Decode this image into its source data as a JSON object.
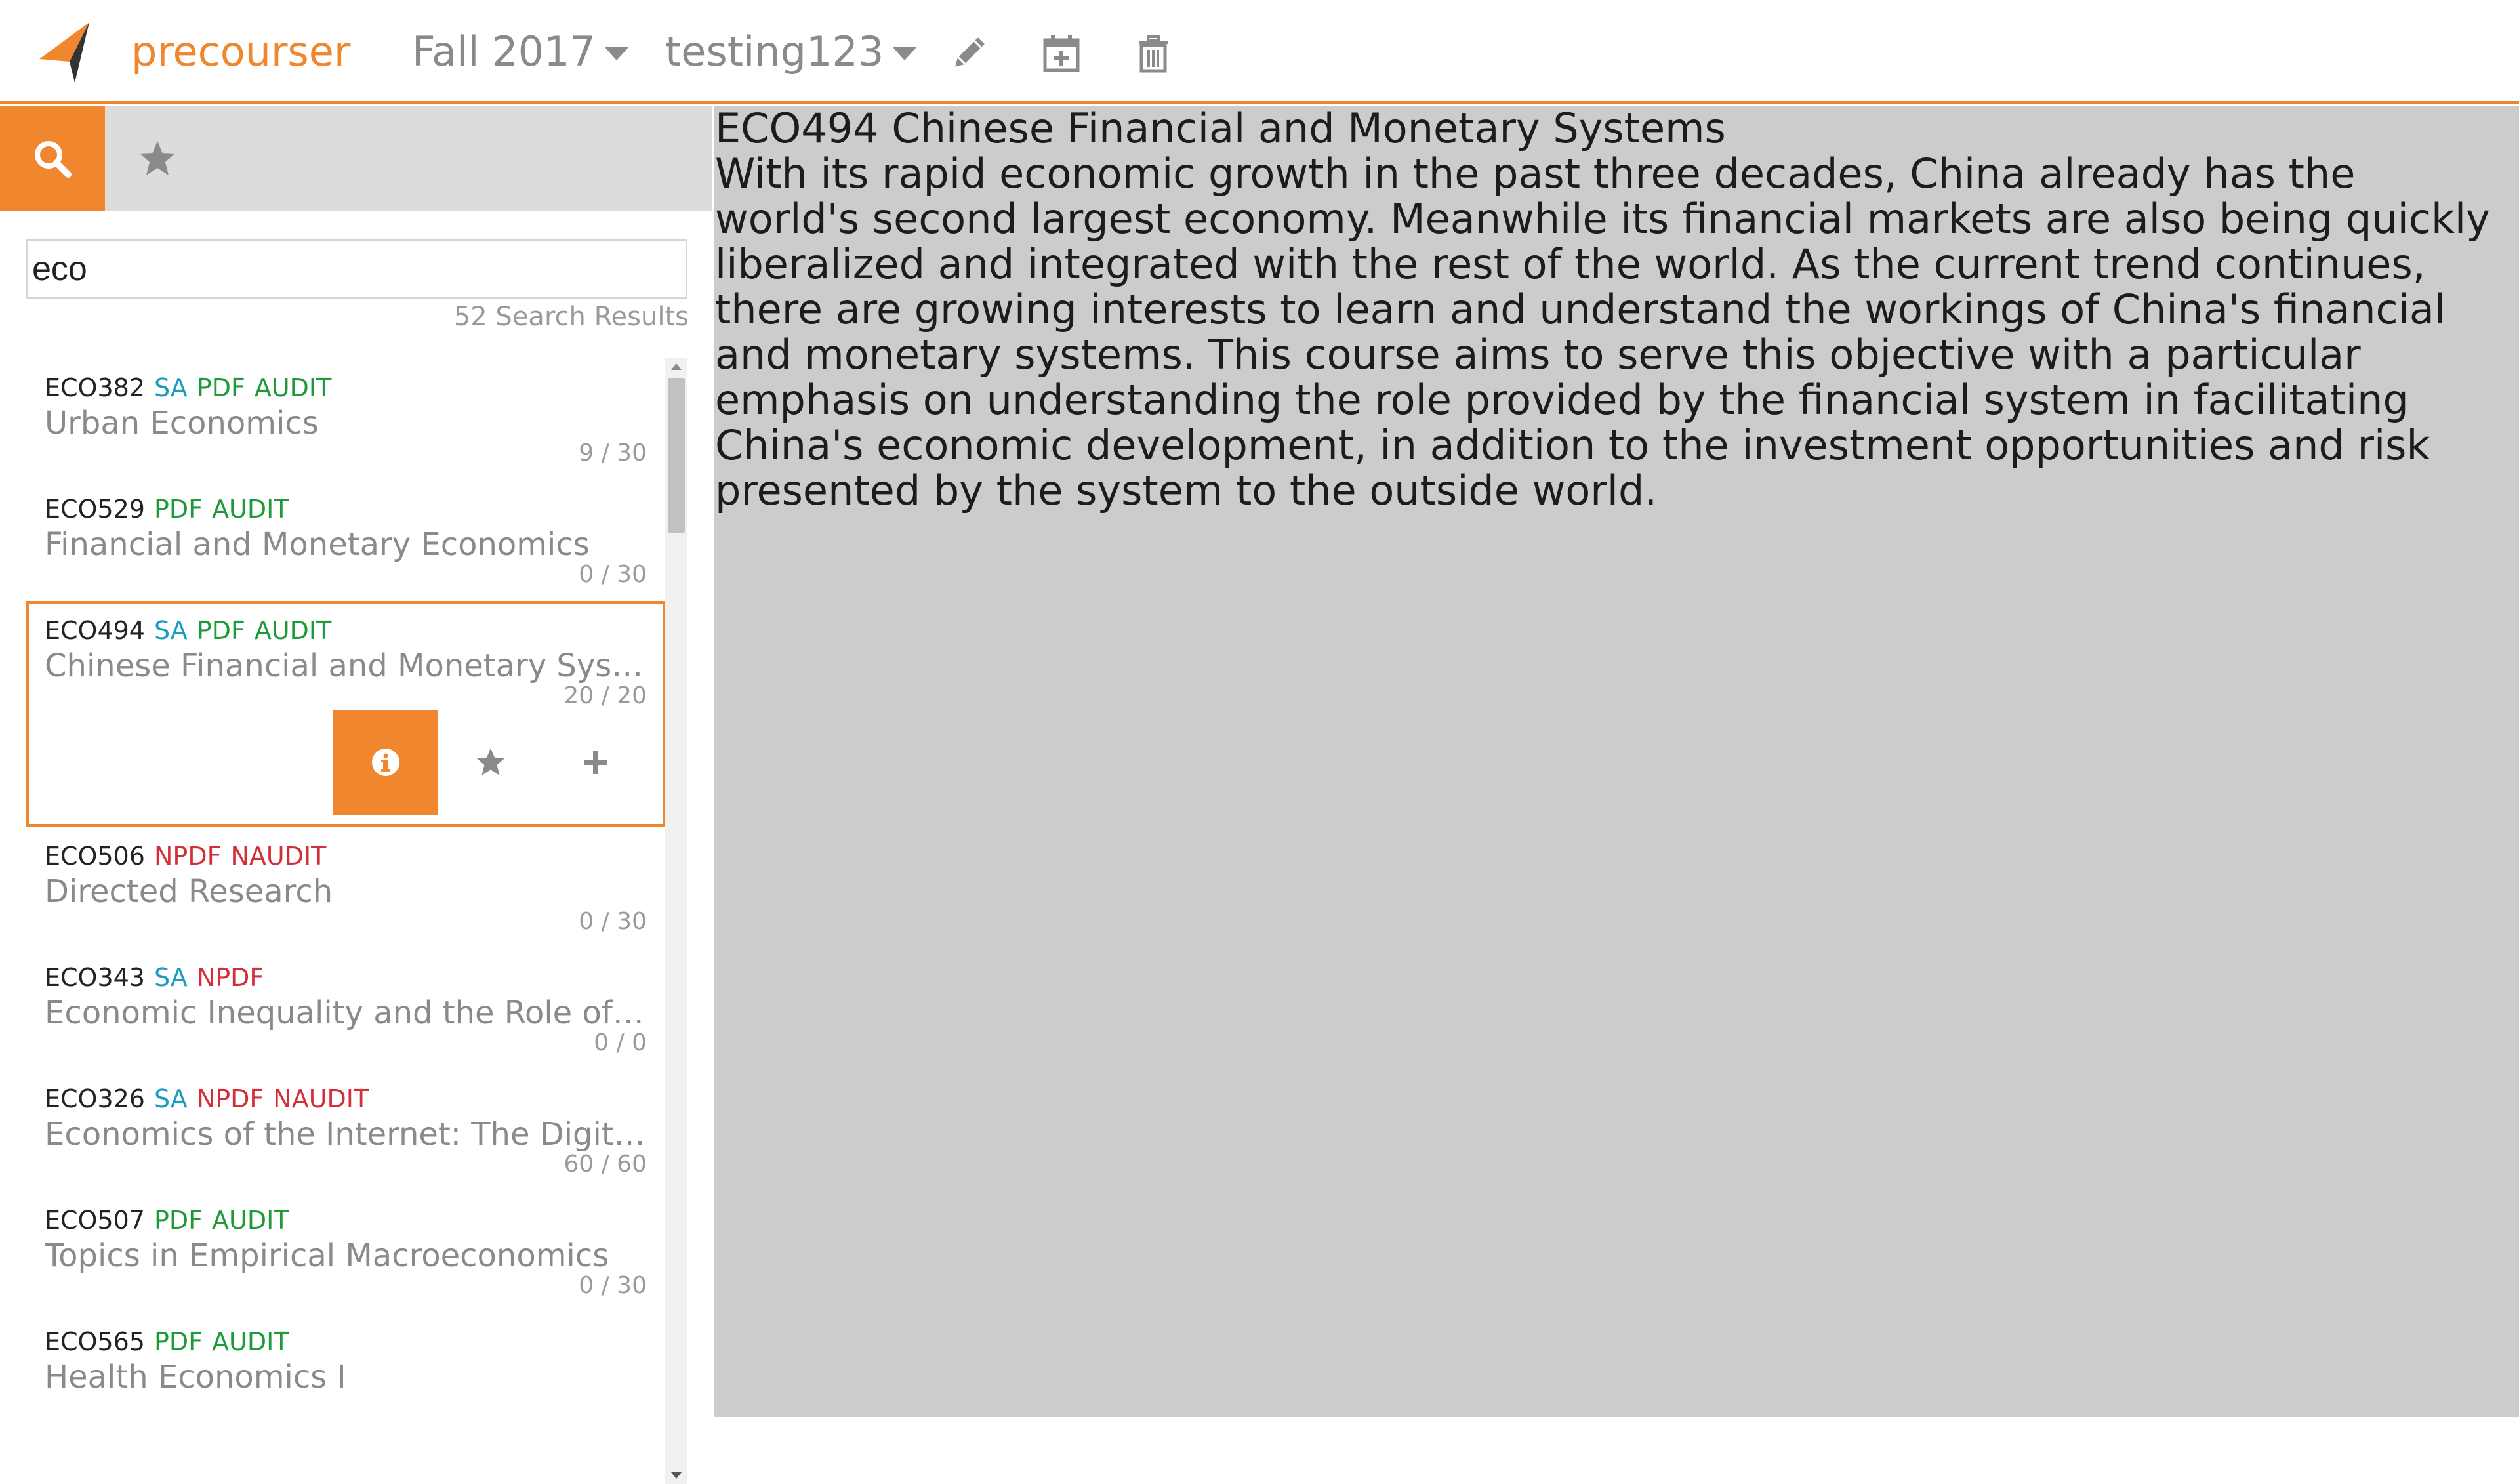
{
  "app": {
    "brand": "precourser"
  },
  "header": {
    "term": "Fall 2017",
    "schedule": "testing123",
    "icons": [
      "pencil-icon",
      "calendar-plus-icon",
      "trash-icon"
    ]
  },
  "sidebar": {
    "tabs": [
      "search-icon",
      "star-icon"
    ],
    "search": {
      "value": "eco",
      "placeholder": ""
    },
    "result_count": "52 Search Results",
    "courses": [
      {
        "code": "ECO382",
        "tags": [
          {
            "t": "SA",
            "k": "sa"
          },
          {
            "t": "PDF",
            "k": "ok"
          },
          {
            "t": "AUDIT",
            "k": "ok"
          }
        ],
        "title": "Urban Economics",
        "enrollment": "9 / 30"
      },
      {
        "code": "ECO529",
        "tags": [
          {
            "t": "PDF",
            "k": "ok"
          },
          {
            "t": "AUDIT",
            "k": "ok"
          }
        ],
        "title": "Financial and Monetary Economics",
        "enrollment": "0 / 30"
      },
      {
        "code": "ECO494",
        "tags": [
          {
            "t": "SA",
            "k": "sa"
          },
          {
            "t": "PDF",
            "k": "ok"
          },
          {
            "t": "AUDIT",
            "k": "ok"
          }
        ],
        "title": "Chinese Financial and Monetary Systems",
        "enrollment": "20 / 20",
        "selected": true
      },
      {
        "code": "ECO506",
        "tags": [
          {
            "t": "NPDF",
            "k": "no"
          },
          {
            "t": "NAUDIT",
            "k": "no"
          }
        ],
        "title": "Directed Research",
        "enrollment": "0 / 30"
      },
      {
        "code": "ECO343",
        "tags": [
          {
            "t": "SA",
            "k": "sa"
          },
          {
            "t": "NPDF",
            "k": "no"
          }
        ],
        "title": "Economic Inequality and the Role of Government",
        "enrollment": "0 / 0"
      },
      {
        "code": "ECO326",
        "tags": [
          {
            "t": "SA",
            "k": "sa"
          },
          {
            "t": "NPDF",
            "k": "no"
          },
          {
            "t": "NAUDIT",
            "k": "no"
          }
        ],
        "title": "Economics of the Internet: The Digital Revolution",
        "enrollment": "60 / 60"
      },
      {
        "code": "ECO507",
        "tags": [
          {
            "t": "PDF",
            "k": "ok"
          },
          {
            "t": "AUDIT",
            "k": "ok"
          }
        ],
        "title": "Topics in Empirical Macroeconomics",
        "enrollment": "0 / 30"
      },
      {
        "code": "ECO565",
        "tags": [
          {
            "t": "PDF",
            "k": "ok"
          },
          {
            "t": "AUDIT",
            "k": "ok"
          }
        ],
        "title": "Health Economics I",
        "enrollment": ""
      }
    ],
    "selected_actions": [
      "info-icon",
      "star-icon",
      "plus-icon"
    ]
  },
  "detail": {
    "heading": "ECO494 Chinese Financial and Monetary Systems",
    "description": "With its rapid economic growth in the past three decades, China already has the world's second largest economy. Meanwhile its financial markets are also being quickly liberalized and integrated with the rest of the world. As the current trend continues, there are growing interests to learn and understand the workings of China's financial and monetary systems. This course aims to serve this objective with a particular emphasis on understanding the role provided by the financial system in facilitating China's economic development, in addition to the investment opportunities and risk presented by the system to the outside world."
  },
  "colors": {
    "accent": "#f0862e",
    "panel": "#cccccc",
    "tag_sa": "#1a9bbf",
    "tag_ok": "#1f9a3a",
    "tag_no": "#d32f3a"
  }
}
